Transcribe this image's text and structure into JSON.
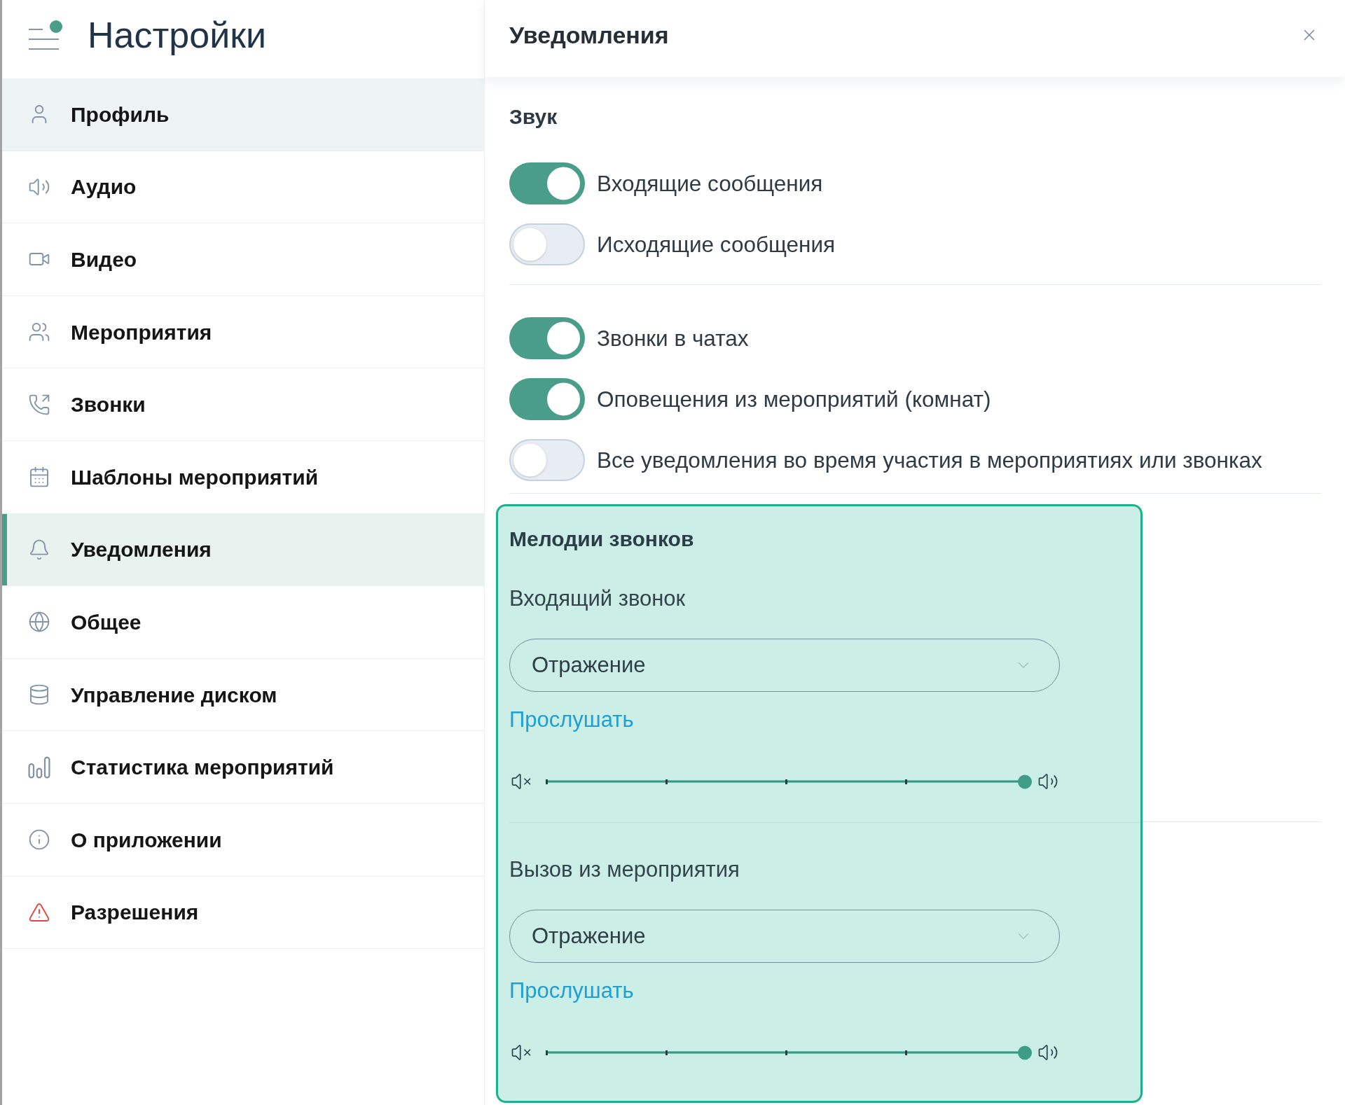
{
  "sidebar": {
    "title": "Настройки",
    "notification_dot": true,
    "items": [
      {
        "label": "Профиль",
        "selected": false,
        "hovered": true
      },
      {
        "label": "Аудио",
        "selected": false,
        "hovered": false
      },
      {
        "label": "Видео",
        "selected": false,
        "hovered": false
      },
      {
        "label": "Мероприятия",
        "selected": false,
        "hovered": false
      },
      {
        "label": "Звонки",
        "selected": false,
        "hovered": false
      },
      {
        "label": "Шаблоны мероприятий",
        "selected": false,
        "hovered": false
      },
      {
        "label": "Уведомления",
        "selected": true,
        "hovered": false
      },
      {
        "label": "Общее",
        "selected": false,
        "hovered": false
      },
      {
        "label": "Управление диском",
        "selected": false,
        "hovered": false
      },
      {
        "label": "Статистика мероприятий",
        "selected": false,
        "hovered": false
      },
      {
        "label": "О приложении",
        "selected": false,
        "hovered": false
      },
      {
        "label": "Разрешения",
        "selected": false,
        "hovered": false
      }
    ]
  },
  "panel": {
    "title": "Уведомления",
    "sound": {
      "heading": "Звук",
      "groups": [
        {
          "toggles": [
            {
              "label": "Входящие сообщения",
              "on": true
            },
            {
              "label": "Исходящие сообщения",
              "on": false
            }
          ]
        },
        {
          "toggles": [
            {
              "label": "Звонки в чатах",
              "on": true
            },
            {
              "label": "Оповещения из мероприятий (комнат)",
              "on": true
            },
            {
              "label": "Все уведомления во время участия в мероприятиях или звонках",
              "on": false
            }
          ]
        }
      ]
    },
    "ringtones": {
      "heading": "Мелодии звонков",
      "items": [
        {
          "label": "Входящий звонок",
          "value": "Отражение",
          "link": "Прослушать",
          "level": 1
        },
        {
          "label": "Вызов из мероприятия",
          "value": "Отражение",
          "link": "Прослушать",
          "level": 1
        }
      ]
    }
  }
}
